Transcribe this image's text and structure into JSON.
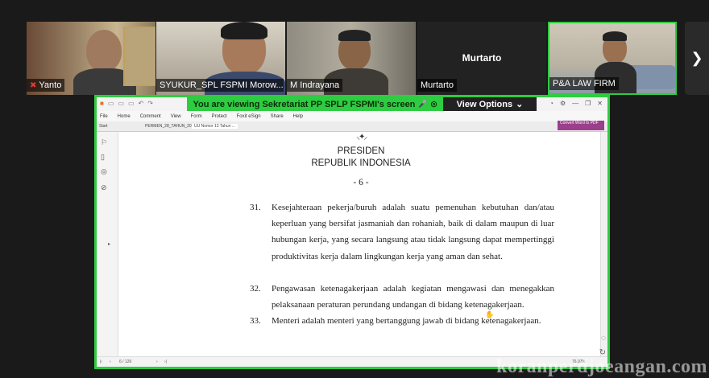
{
  "participants": [
    {
      "name": "Yanto",
      "muted": true
    },
    {
      "name": "SYUKUR_SPL FSPMI Morow..."
    },
    {
      "name": "M Indrayana"
    },
    {
      "name": "Murtarto",
      "center_label": "Murtarto"
    },
    {
      "name": "P&A LAW FIRM",
      "active": true
    }
  ],
  "nav": {
    "next_icon": "chevron-right-icon",
    "next_glyph": "❯"
  },
  "share": {
    "banner_text": "You are viewing Sekretariat PP SPLP FSPMI's screen",
    "view_options_label": "View Options"
  },
  "app": {
    "menu": [
      "File",
      "Home",
      "Comment",
      "View",
      "Form",
      "Protect",
      "Foxit eSign",
      "Share",
      "Help"
    ],
    "tabs": [
      "Start",
      "PERMEN_28_TAHUN_201...",
      "UU Nomor 13 Tahun ..."
    ],
    "convert_label": "Convert Word to PDF",
    "page_indicator": "6 / 126",
    "zoom": "76.97%"
  },
  "document": {
    "heading1": "PRESIDEN",
    "heading2": "REPUBLIK INDONESIA",
    "page_number": "- 6 -",
    "items": [
      {
        "num": "31.",
        "text": "Kesejahteraan pekerja/buruh adalah suatu pemenuhan kebutuhan dan/atau keperluan yang bersifat jasmaniah dan rohaniah, baik di dalam maupun di luar hubungan kerja, yang secara langsung atau tidak langsung dapat mempertinggi produktivitas kerja dalam lingkungan kerja yang aman dan sehat."
      },
      {
        "num": "32.",
        "text": "Pengawasan ketenagakerjaan adalah kegiatan mengawasi dan menegakkan pelaksanaan peraturan perundang undangan di bidang ketenagakerjaan."
      },
      {
        "num": "33.",
        "text": "Menteri adalah menteri yang bertanggung jawab di bidang ketenagakerjaan."
      }
    ]
  },
  "watermark": "koranperdjoeangan.com",
  "colors": {
    "active_border": "#2ecc40",
    "convert": "#9b3f8c"
  }
}
